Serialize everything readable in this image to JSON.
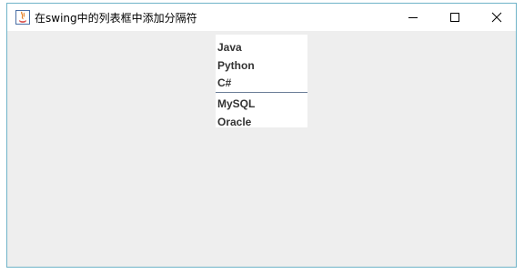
{
  "window": {
    "title": "在swing中的列表框中添加分隔符",
    "icon": "java-coffee-icon",
    "controls": {
      "minimize": "minimize-icon",
      "maximize": "maximize-icon",
      "close": "close-icon"
    }
  },
  "list": {
    "items_before_separator": [
      {
        "label": "Java"
      },
      {
        "label": "Python"
      },
      {
        "label": "C#"
      }
    ],
    "items_after_separator": [
      {
        "label": "MySQL"
      },
      {
        "label": "Oracle"
      }
    ],
    "separator_color": "#6a7d97"
  },
  "colors": {
    "window_border": "#6fb3c8",
    "client_background": "#eeeeee",
    "list_background": "#ffffff",
    "item_text": "#333333"
  }
}
